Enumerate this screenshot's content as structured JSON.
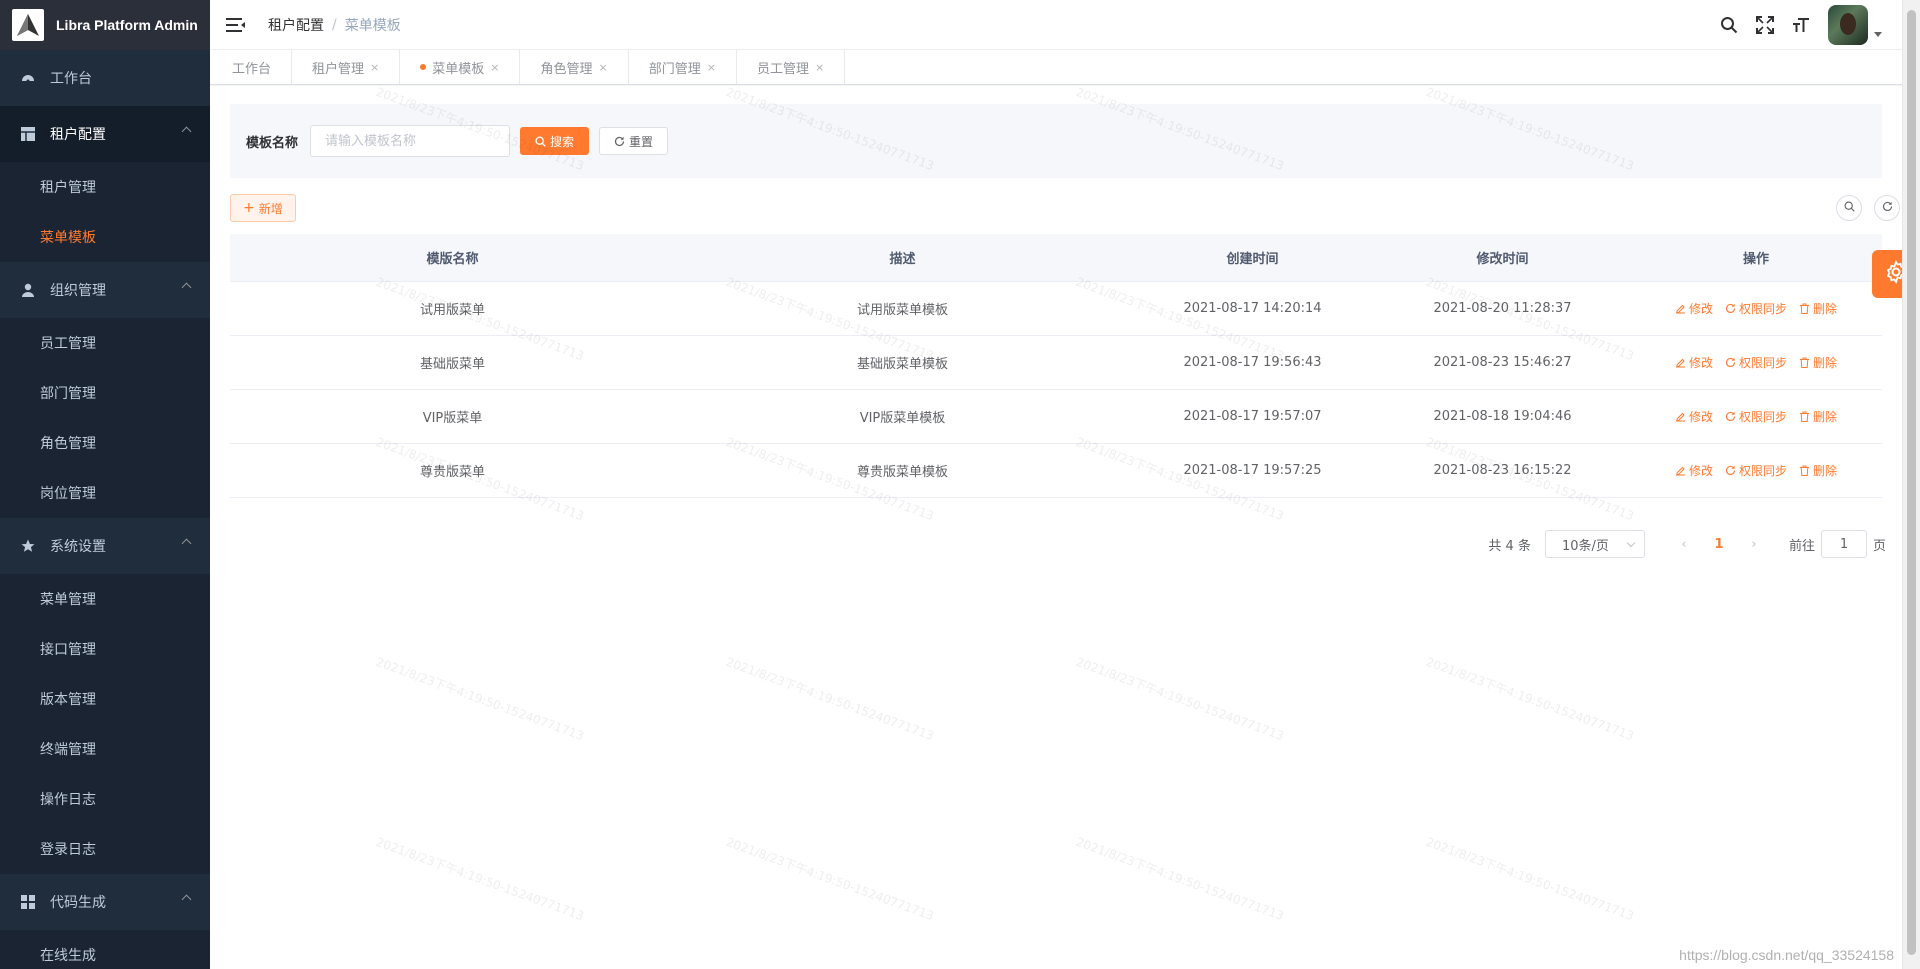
{
  "app": {
    "title": "Libra Platform Admin"
  },
  "sidebar": {
    "dashboard": "工作台",
    "groups": [
      {
        "label": "租户配置",
        "items": [
          "租户管理",
          "菜单模板"
        ]
      },
      {
        "label": "组织管理",
        "items": [
          "员工管理",
          "部门管理",
          "角色管理",
          "岗位管理"
        ]
      },
      {
        "label": "系统设置",
        "items": [
          "菜单管理",
          "接口管理",
          "版本管理",
          "终端管理",
          "操作日志",
          "登录日志"
        ]
      },
      {
        "label": "代码生成",
        "items": [
          "在线生成"
        ]
      }
    ],
    "active_item": "菜单模板",
    "active_color": "#ff7a2e"
  },
  "header": {
    "breadcrumb": [
      "租户配置",
      "菜单模板"
    ],
    "icons": [
      "search-icon",
      "fullscreen-icon",
      "font-size-icon",
      "avatar"
    ]
  },
  "tags": [
    {
      "label": "工作台",
      "closable": false,
      "active": false
    },
    {
      "label": "租户管理",
      "closable": true,
      "active": false
    },
    {
      "label": "菜单模板",
      "closable": true,
      "active": true
    },
    {
      "label": "角色管理",
      "closable": true,
      "active": false
    },
    {
      "label": "部门管理",
      "closable": true,
      "active": false
    },
    {
      "label": "员工管理",
      "closable": true,
      "active": false
    }
  ],
  "search": {
    "label": "模板名称",
    "placeholder": "请输入模板名称",
    "search_btn": "搜索",
    "reset_btn": "重置"
  },
  "toolbar": {
    "add_btn": "新增"
  },
  "table": {
    "columns": [
      "模版名称",
      "描述",
      "创建时间",
      "修改时间",
      "操作"
    ],
    "rows": [
      {
        "name": "试用版菜单",
        "desc": "试用版菜单模板",
        "created": "2021-08-17 14:20:14",
        "modified": "2021-08-20 11:28:37"
      },
      {
        "name": "基础版菜单",
        "desc": "基础版菜单模板",
        "created": "2021-08-17 19:56:43",
        "modified": "2021-08-23 15:46:27"
      },
      {
        "name": "VIP版菜单",
        "desc": "VIP版菜单模板",
        "created": "2021-08-17 19:57:07",
        "modified": "2021-08-18 19:04:46"
      },
      {
        "name": "尊贵版菜单",
        "desc": "尊贵版菜单模板",
        "created": "2021-08-17 19:57:25",
        "modified": "2021-08-23 16:15:22"
      }
    ],
    "actions": [
      "修改",
      "权限同步",
      "删除"
    ]
  },
  "pagination": {
    "total": "共 4 条",
    "page_size": "10条/页",
    "current_page": "1",
    "goto_prefix": "前往",
    "goto_value": "1",
    "goto_suffix": "页"
  },
  "watermark": "2021/8/23下午4:19:50-15240771713",
  "footer_url": "https://blog.csdn.net/qq_33524158",
  "colors": {
    "accent": "#ff7a2e",
    "sidebar_bg": "#1f2d3d"
  }
}
